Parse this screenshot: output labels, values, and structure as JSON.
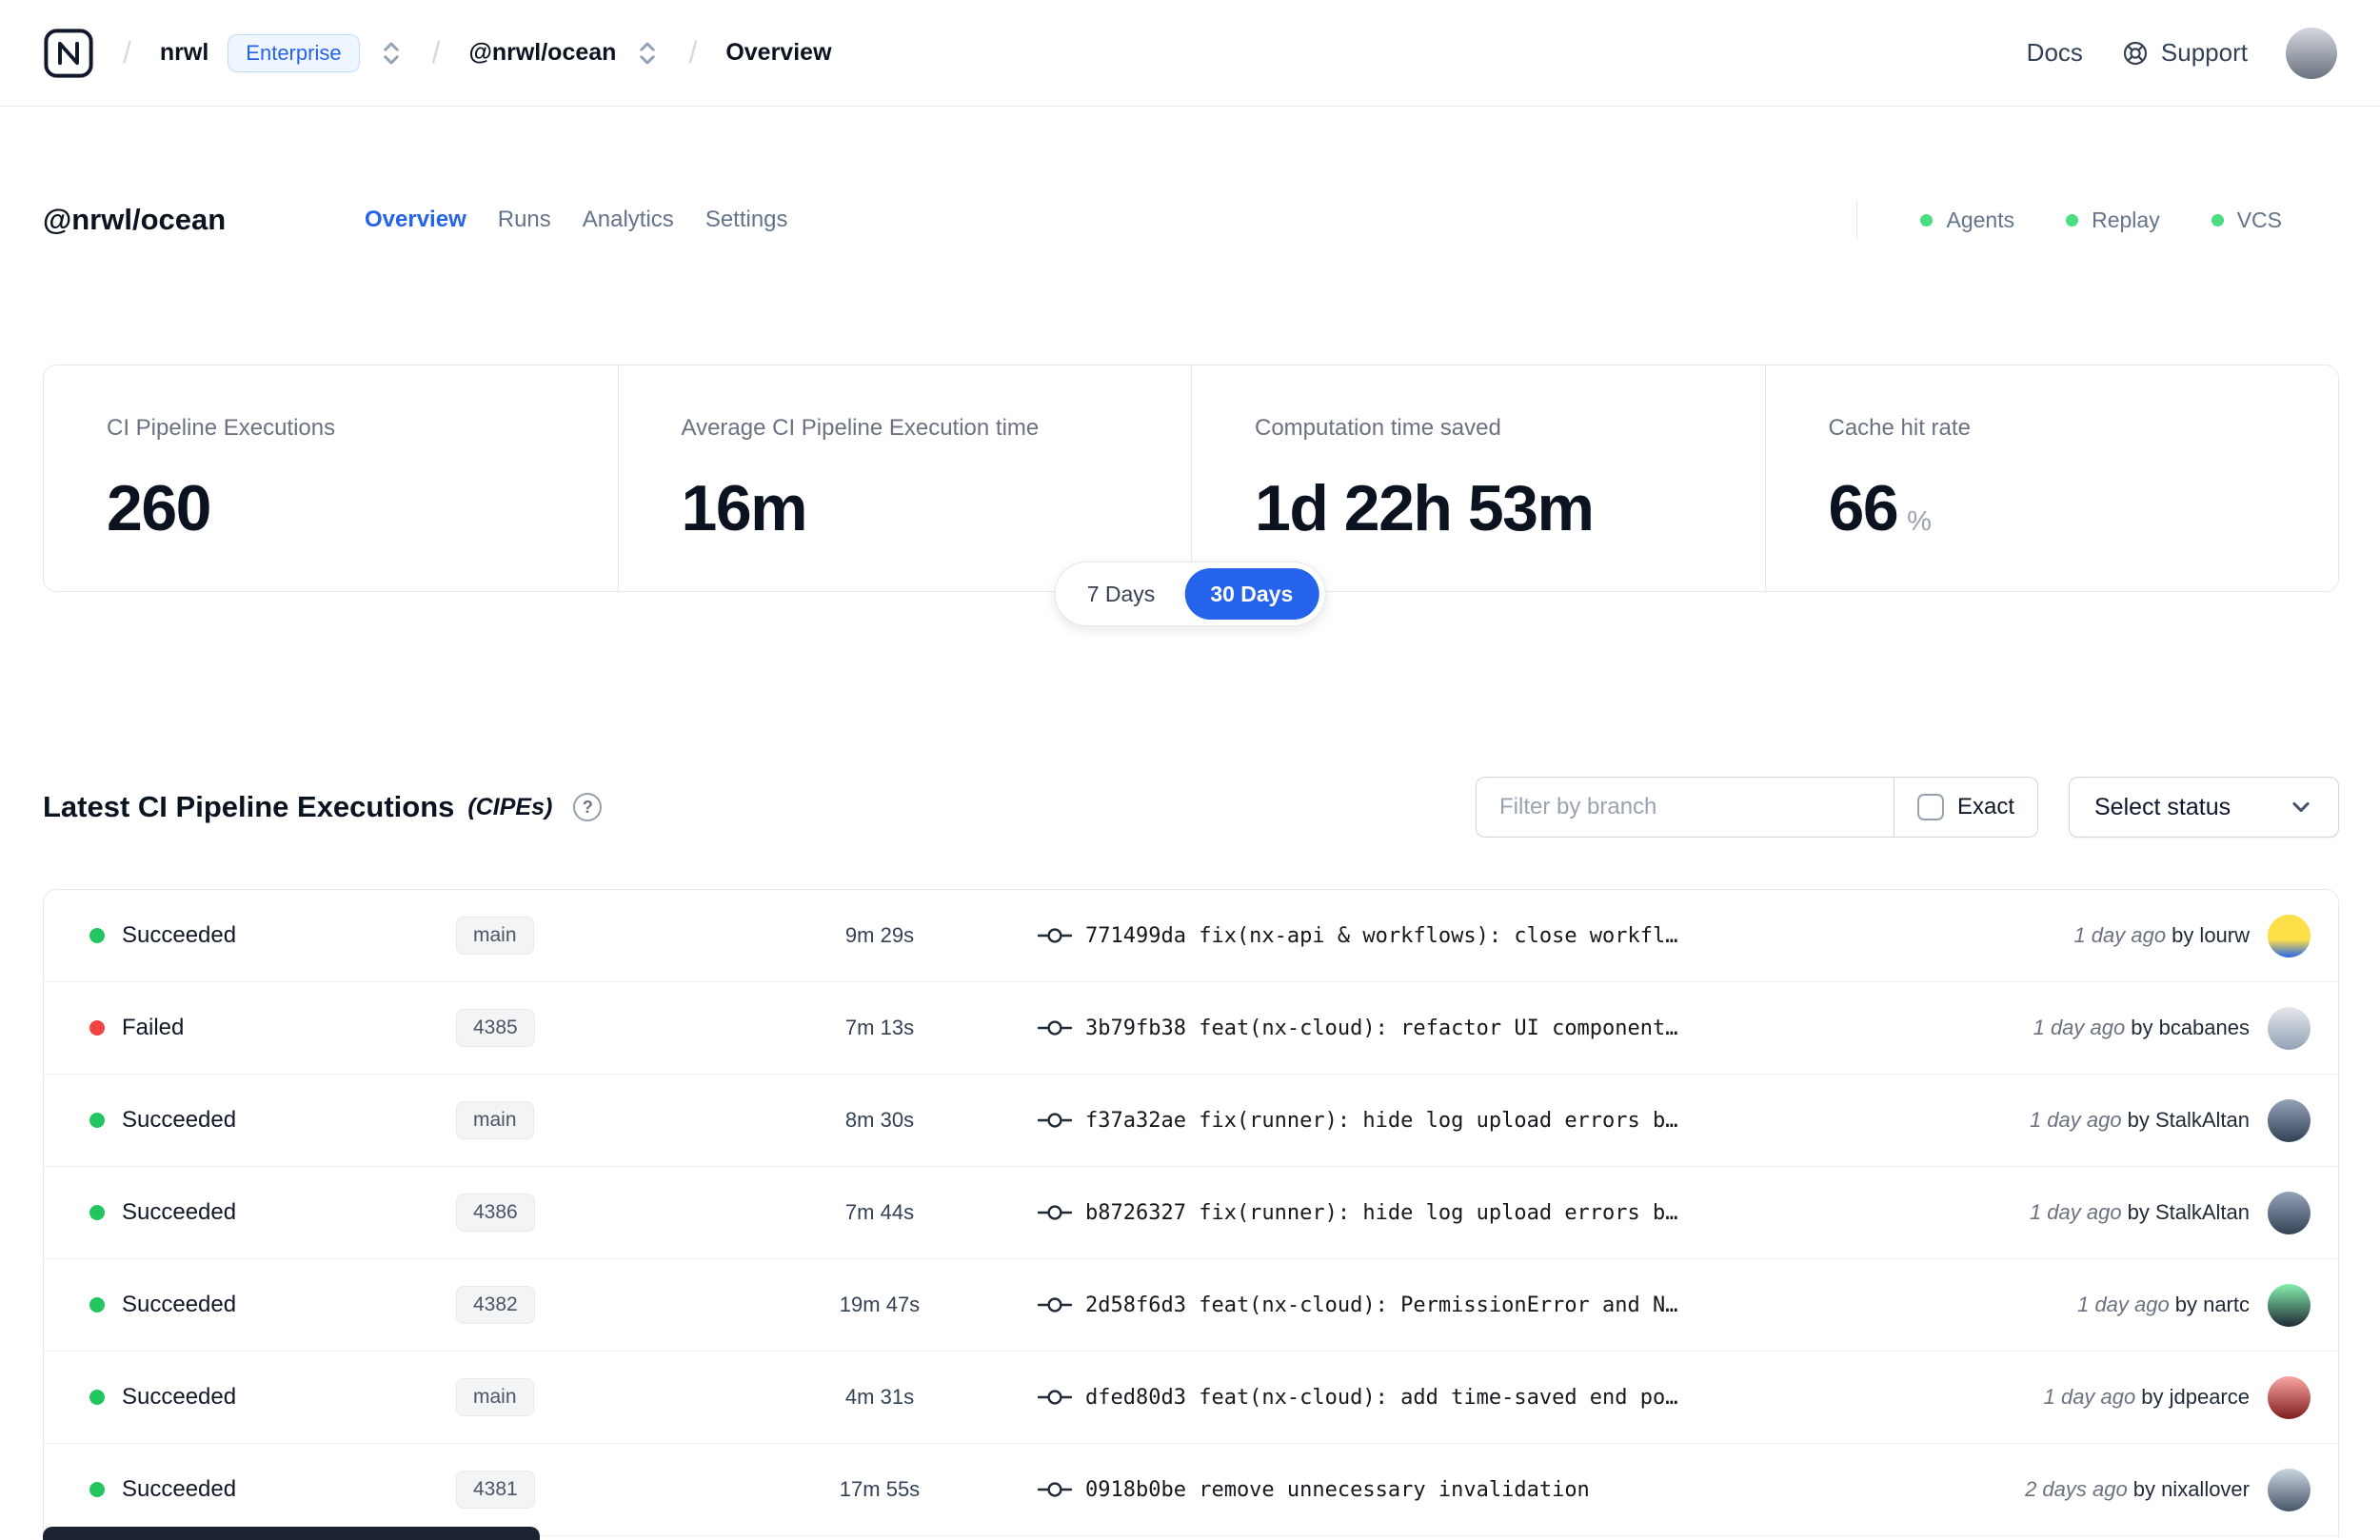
{
  "colors": {
    "accent-blue": "#2563eb",
    "green": "#22c55e",
    "red": "#ef4444",
    "indicator-green": "#4ade80"
  },
  "topbar": {
    "breadcrumb": {
      "separator": "/",
      "org": "nrwl",
      "org_badge": "Enterprise",
      "workspace": "@nrwl/ocean",
      "page": "Overview"
    },
    "docs_link": "Docs",
    "support_link": "Support",
    "avatar_bg": "linear-gradient(180deg,#d3d7de 0%,#6b7280 100%)"
  },
  "header": {
    "title": "@nrwl/ocean",
    "tabs": [
      {
        "label": "Overview",
        "active": true
      },
      {
        "label": "Runs",
        "active": false
      },
      {
        "label": "Analytics",
        "active": false
      },
      {
        "label": "Settings",
        "active": false
      }
    ],
    "indicators": [
      {
        "label": "Agents"
      },
      {
        "label": "Replay"
      },
      {
        "label": "VCS"
      }
    ]
  },
  "stats": {
    "cards": [
      {
        "label": "CI Pipeline Executions",
        "value": "260",
        "suffix": ""
      },
      {
        "label": "Average CI Pipeline Execution time",
        "value": "16m",
        "suffix": ""
      },
      {
        "label": "Computation time saved",
        "value": "1d 22h 53m",
        "suffix": ""
      },
      {
        "label": "Cache hit rate",
        "value": "66",
        "suffix": "%"
      }
    ],
    "range_toggle": [
      {
        "label": "7 Days",
        "active": false
      },
      {
        "label": "30 Days",
        "active": true
      }
    ]
  },
  "cipes": {
    "title": "Latest CI Pipeline Executions",
    "title_suffix": "(CIPEs)",
    "help_icon": "?",
    "filter": {
      "placeholder": "Filter by branch",
      "exact_label": "Exact"
    },
    "status_dropdown": "Select status",
    "rows": [
      {
        "status": "Succeeded",
        "status_type": "success",
        "branch": "main",
        "duration": "9m 29s",
        "commit": "771499da fix(nx-api & workflows): close workfl…",
        "time": "1 day ago",
        "author": "by lourw",
        "avatar_bg": "linear-gradient(180deg,#fde047 58%,#2563eb 100%)"
      },
      {
        "status": "Failed",
        "status_type": "failed",
        "branch": "4385",
        "duration": "7m 13s",
        "commit": "3b79fb38 feat(nx-cloud): refactor UI component…",
        "time": "1 day ago",
        "author": "by bcabanes",
        "avatar_bg": "linear-gradient(180deg,#e5e7eb 0%,#94a3b8 100%)"
      },
      {
        "status": "Succeeded",
        "status_type": "success",
        "branch": "main",
        "duration": "8m 30s",
        "commit": "f37a32ae fix(runner): hide log upload errors b…",
        "time": "1 day ago",
        "author": "by StalkAltan",
        "avatar_bg": "linear-gradient(180deg,#94a3b8 0%,#334155 100%)"
      },
      {
        "status": "Succeeded",
        "status_type": "success",
        "branch": "4386",
        "duration": "7m 44s",
        "commit": "b8726327 fix(runner): hide log upload errors b…",
        "time": "1 day ago",
        "author": "by StalkAltan",
        "avatar_bg": "linear-gradient(180deg,#94a3b8 0%,#334155 100%)"
      },
      {
        "status": "Succeeded",
        "status_type": "success",
        "branch": "4382",
        "duration": "19m 47s",
        "commit": "2d58f6d3 feat(nx-cloud): PermissionError and N…",
        "time": "1 day ago",
        "author": "by nartc",
        "avatar_bg": "linear-gradient(180deg,#86efac 0%,#1f2937 100%)"
      },
      {
        "status": "Succeeded",
        "status_type": "success",
        "branch": "main",
        "duration": "4m 31s",
        "commit": "dfed80d3 feat(nx-cloud): add time-saved end po…",
        "time": "1 day ago",
        "author": "by jdpearce",
        "avatar_bg": "linear-gradient(180deg,#fca5a5 0%,#7f1d1d 100%)"
      },
      {
        "status": "Succeeded",
        "status_type": "success",
        "branch": "4381",
        "duration": "17m 55s",
        "commit": "0918b0be remove unnecessary invalidation",
        "time": "2 days ago",
        "author": "by nixallover",
        "avatar_bg": "linear-gradient(180deg,#cbd5e1 0%,#475569 100%)"
      }
    ]
  }
}
